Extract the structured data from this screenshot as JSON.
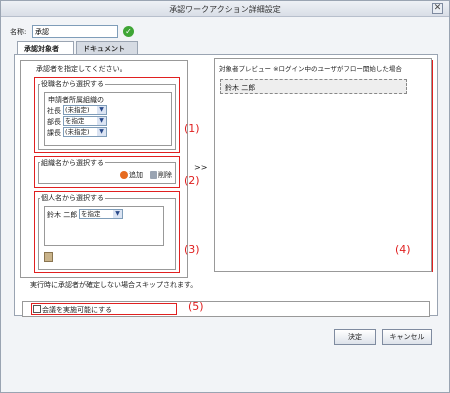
{
  "window": {
    "title": "承認ワークアクション詳細設定",
    "close_symbol": "✕"
  },
  "name_row": {
    "label": "名称:",
    "value": "承認",
    "check_icon": "check-circle-icon"
  },
  "tabs": [
    {
      "label": "承認対象者",
      "active": true
    },
    {
      "label": "ドキュメント",
      "active": false
    }
  ],
  "left": {
    "hint": "承認者を指定してください。",
    "role_section": {
      "legend": "役職名から選択する",
      "group_label": "申請者所属組織の",
      "rows": [
        {
          "label": "社長",
          "value": "(未指定)"
        },
        {
          "label": "部長",
          "value": "を指定"
        },
        {
          "label": "課長",
          "value": "(未指定)"
        }
      ]
    },
    "org_section": {
      "legend": "組織名から選択する",
      "add_label": "追加",
      "delete_label": "削除"
    },
    "person_section": {
      "legend": "個人名から選択する",
      "person_name": "鈴木 二郎",
      "person_value": "を指定"
    }
  },
  "transfer_arrow": ">>",
  "preview": {
    "title": "対象者プレビュー ※ログイン中のユーザがフロー開始した場合",
    "items": [
      "鈴木 二郎"
    ]
  },
  "skip_note": "実行時に承認者が確定しない場合スキップされます。",
  "conference": {
    "label": "会議を実施可能にする",
    "checked": false
  },
  "annotations": [
    "(1)",
    "(2)",
    "(3)",
    "(4)",
    "(5)"
  ],
  "buttons": {
    "ok": "決定",
    "cancel": "キャンセル"
  },
  "colors": {
    "annotation_red": "#e02020",
    "check_green": "#3fa535",
    "add_orange": "#e66a1f"
  }
}
